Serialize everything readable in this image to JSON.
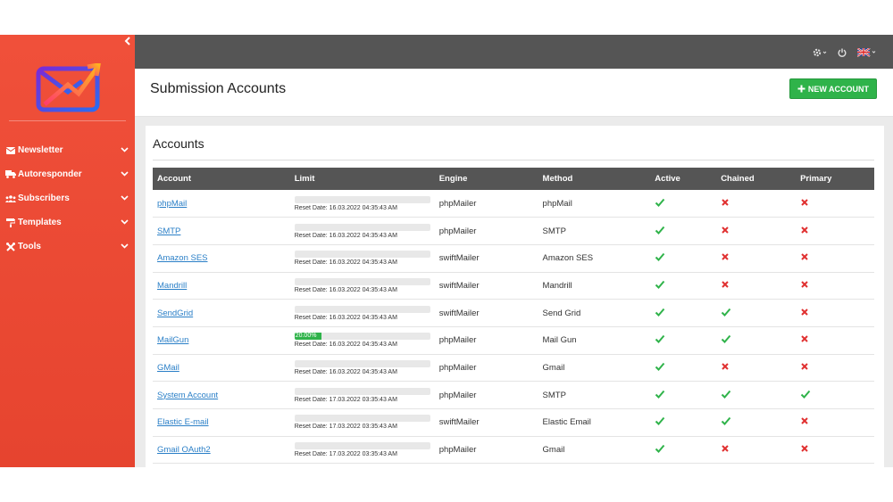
{
  "header": {
    "title": "Submission Accounts",
    "new_button": "NEW ACCOUNT"
  },
  "sidebar": {
    "items": [
      {
        "label": "Newsletter",
        "icon": "envelope-icon"
      },
      {
        "label": "Autoresponder",
        "icon": "truck-icon"
      },
      {
        "label": "Subscribers",
        "icon": "users-icon"
      },
      {
        "label": "Templates",
        "icon": "paint-roller-icon"
      },
      {
        "label": "Tools",
        "icon": "tools-icon"
      }
    ]
  },
  "card": {
    "title": "Accounts"
  },
  "table": {
    "headers": {
      "account": "Account",
      "limit": "Limit",
      "engine": "Engine",
      "method": "Method",
      "active": "Active",
      "chained": "Chained",
      "primary": "Primary"
    },
    "rows": [
      {
        "account": "phpMail",
        "progress": 0,
        "progress_label": "",
        "reset": "Reset Date: 16.03.2022 04:35:43 AM",
        "engine": "phpMailer",
        "method": "phpMail",
        "active": true,
        "chained": false,
        "primary": false
      },
      {
        "account": "SMTP",
        "progress": 0,
        "progress_label": "",
        "reset": "Reset Date: 16.03.2022 04:35:43 AM",
        "engine": "phpMailer",
        "method": "SMTP",
        "active": true,
        "chained": false,
        "primary": false
      },
      {
        "account": "Amazon SES",
        "progress": 0,
        "progress_label": "",
        "reset": "Reset Date: 16.03.2022 04:35:43 AM",
        "engine": "swiftMailer",
        "method": "Amazon SES",
        "active": true,
        "chained": false,
        "primary": false
      },
      {
        "account": "Mandrill",
        "progress": 0,
        "progress_label": "",
        "reset": "Reset Date: 16.03.2022 04:35:43 AM",
        "engine": "swiftMailer",
        "method": "Mandrill",
        "active": true,
        "chained": false,
        "primary": false
      },
      {
        "account": "SendGrid",
        "progress": 0,
        "progress_label": "",
        "reset": "Reset Date: 16.03.2022 04:35:43 AM",
        "engine": "swiftMailer",
        "method": "Send Grid",
        "active": true,
        "chained": true,
        "primary": false
      },
      {
        "account": "MailGun",
        "progress": 20,
        "progress_label": "20.00%",
        "reset": "Reset Date: 16.03.2022 04:35:43 AM",
        "engine": "phpMailer",
        "method": "Mail Gun",
        "active": true,
        "chained": true,
        "primary": false
      },
      {
        "account": "GMail",
        "progress": 0,
        "progress_label": "",
        "reset": "Reset Date: 16.03.2022 04:35:43 AM",
        "engine": "phpMailer",
        "method": "Gmail",
        "active": true,
        "chained": false,
        "primary": false
      },
      {
        "account": "System Account",
        "progress": 0,
        "progress_label": "",
        "reset": "Reset Date: 17.03.2022 03:35:43 AM",
        "engine": "phpMailer",
        "method": "SMTP",
        "active": true,
        "chained": true,
        "primary": true
      },
      {
        "account": "Elastic E-mail",
        "progress": 0,
        "progress_label": "",
        "reset": "Reset Date: 17.03.2022 03:35:43 AM",
        "engine": "swiftMailer",
        "method": "Elastic Email",
        "active": true,
        "chained": true,
        "primary": false
      },
      {
        "account": "Gmail OAuth2",
        "progress": 0,
        "progress_label": "",
        "reset": "Reset Date: 17.03.2022 03:35:43 AM",
        "engine": "phpMailer",
        "method": "Gmail",
        "active": true,
        "chained": false,
        "primary": false
      }
    ]
  },
  "colors": {
    "sidebar": "#e6442f",
    "topbar": "#555555",
    "success": "#2fb34a",
    "danger": "#e03030",
    "link": "#2a7fc7"
  }
}
